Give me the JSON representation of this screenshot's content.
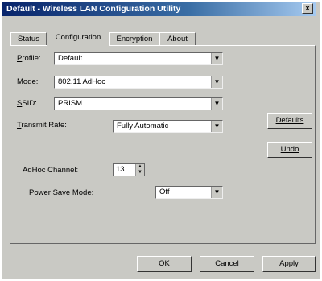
{
  "window": {
    "title": "Default - Wireless LAN Configuration Utility",
    "close_glyph": "x"
  },
  "tabs": [
    {
      "label": "Status",
      "active": false
    },
    {
      "label": "Configuration",
      "active": true
    },
    {
      "label": "Encryption",
      "active": false
    },
    {
      "label": "About",
      "active": false
    }
  ],
  "config": {
    "profile": {
      "label": "Profile:",
      "mnemonic": "P",
      "rest": "rofile:",
      "value": "Default"
    },
    "mode": {
      "label": "Mode:",
      "mnemonic": "M",
      "rest": "ode:",
      "value": "802.11 AdHoc"
    },
    "ssid": {
      "label": "SSID:",
      "mnemonic": "S",
      "rest": "SID:",
      "value": "PRISM"
    },
    "transmit_rate": {
      "label": "Transmit Rate:",
      "mnemonic": "T",
      "rest": "ransmit Rate:",
      "value": "Fully Automatic"
    },
    "adhoc_channel": {
      "label": "AdHoc Channel:",
      "value": "13"
    },
    "power_save": {
      "label": "Power Save Mode:",
      "value": "Off"
    }
  },
  "buttons": {
    "defaults": "Defaults",
    "undo": "Undo",
    "ok": "OK",
    "cancel": "Cancel",
    "apply": "Apply"
  },
  "icons": {
    "dropdown": "chevron-down-icon",
    "spin_up": "spin-up-icon",
    "spin_down": "spin-down-icon"
  }
}
